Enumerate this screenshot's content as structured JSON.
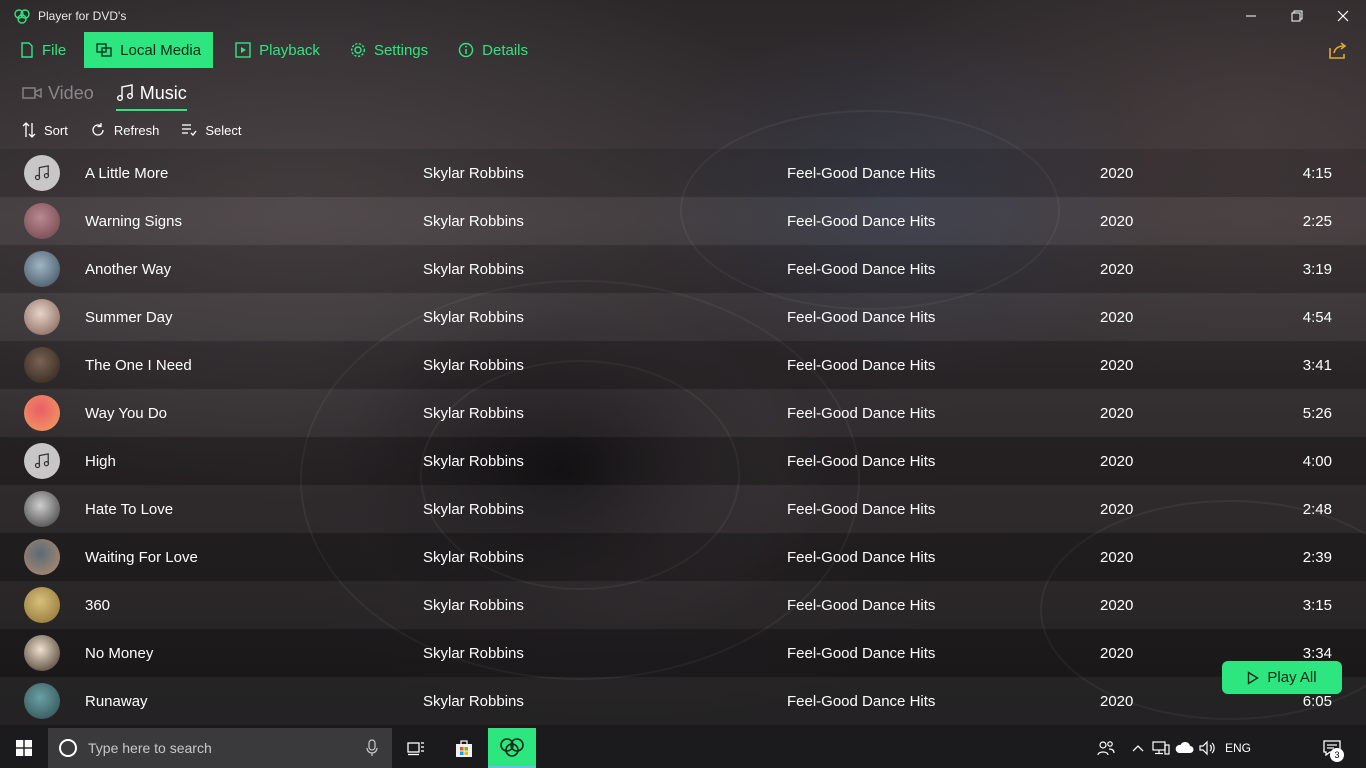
{
  "window": {
    "title": "Player for DVD's"
  },
  "menu": {
    "items": [
      {
        "label": "File",
        "icon": "file-icon"
      },
      {
        "label": "Local Media",
        "icon": "local-media-icon",
        "active": true
      },
      {
        "label": "Playback",
        "icon": "playback-icon"
      },
      {
        "label": "Settings",
        "icon": "gear-icon"
      },
      {
        "label": "Details",
        "icon": "info-icon"
      }
    ]
  },
  "subtabs": {
    "video": "Video",
    "music": "Music",
    "active": "music"
  },
  "toolbar": {
    "sort": "Sort",
    "refresh": "Refresh",
    "select": "Select"
  },
  "tracks": [
    {
      "title": "A Little More",
      "artist": "Skylar Robbins",
      "album": "Feel-Good Dance Hits",
      "year": "2020",
      "duration": "4:15",
      "art": "default"
    },
    {
      "title": "Warning Signs",
      "artist": "Skylar Robbins",
      "album": "Feel-Good Dance Hits",
      "year": "2020",
      "duration": "2:25",
      "art": "photo"
    },
    {
      "title": "Another Way",
      "artist": "Skylar Robbins",
      "album": "Feel-Good Dance Hits",
      "year": "2020",
      "duration": "3:19",
      "art": "photo"
    },
    {
      "title": "Summer Day",
      "artist": "Skylar Robbins",
      "album": "Feel-Good Dance Hits",
      "year": "2020",
      "duration": "4:54",
      "art": "photo"
    },
    {
      "title": "The One I Need",
      "artist": "Skylar Robbins",
      "album": "Feel-Good Dance Hits",
      "year": "2020",
      "duration": "3:41",
      "art": "photo"
    },
    {
      "title": "Way You Do",
      "artist": "Skylar Robbins",
      "album": "Feel-Good Dance Hits",
      "year": "2020",
      "duration": "5:26",
      "art": "photo"
    },
    {
      "title": "High",
      "artist": "Skylar Robbins",
      "album": "Feel-Good Dance Hits",
      "year": "2020",
      "duration": "4:00",
      "art": "default"
    },
    {
      "title": "Hate To Love",
      "artist": "Skylar Robbins",
      "album": "Feel-Good Dance Hits",
      "year": "2020",
      "duration": "2:48",
      "art": "photo"
    },
    {
      "title": "Waiting For Love",
      "artist": "Skylar Robbins",
      "album": "Feel-Good Dance Hits",
      "year": "2020",
      "duration": "2:39",
      "art": "photo"
    },
    {
      "title": "360",
      "artist": "Skylar Robbins",
      "album": "Feel-Good Dance Hits",
      "year": "2020",
      "duration": "3:15",
      "art": "photo"
    },
    {
      "title": "No Money",
      "artist": "Skylar Robbins",
      "album": "Feel-Good Dance Hits",
      "year": "2020",
      "duration": "3:34",
      "art": "photo"
    },
    {
      "title": "Runaway",
      "artist": "Skylar Robbins",
      "album": "Feel-Good Dance Hits",
      "year": "2020",
      "duration": "6:05",
      "art": "photo"
    }
  ],
  "play_all": "Play All",
  "taskbar": {
    "search_placeholder": "Type here to search",
    "language": "ENG",
    "notification_count": "3"
  },
  "colors": {
    "accent": "#2ee67f"
  }
}
